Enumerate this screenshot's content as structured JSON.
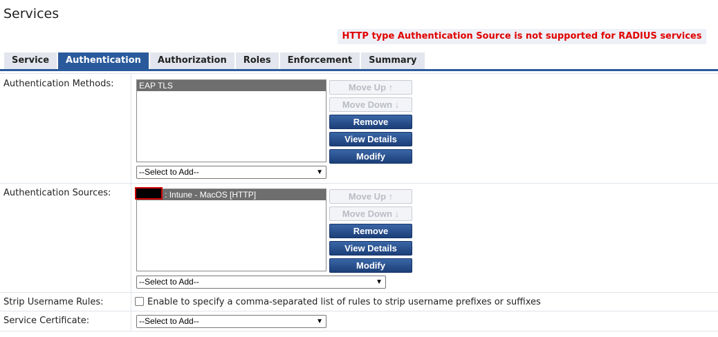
{
  "page": {
    "title": "Services"
  },
  "alert": {
    "text": "HTTP type Authentication Source is not supported for RADIUS services"
  },
  "tabs": [
    {
      "label": "Service"
    },
    {
      "label": "Authentication"
    },
    {
      "label": "Authorization"
    },
    {
      "label": "Roles"
    },
    {
      "label": "Enforcement"
    },
    {
      "label": "Summary"
    }
  ],
  "active_tab": "Authentication",
  "auth_methods": {
    "label": "Authentication Methods:",
    "items": [
      "EAP TLS"
    ],
    "buttons": {
      "move_up": "Move Up ↑",
      "move_down": "Move Down ↓",
      "remove": "Remove",
      "view_details": "View Details",
      "modify": "Modify"
    },
    "select": "--Select to Add--"
  },
  "auth_sources": {
    "label": "Authentication Sources:",
    "items": [
      "Intune - MacOS [HTTP]"
    ],
    "item_prefix": ":",
    "buttons": {
      "move_up": "Move Up ↑",
      "move_down": "Move Down ↓",
      "remove": "Remove",
      "view_details": "View Details",
      "modify": "Modify"
    },
    "select": "--Select to Add--"
  },
  "strip_username": {
    "label": "Strip Username Rules:",
    "checkbox_label": "Enable to specify a comma-separated list of rules to strip username prefixes or suffixes",
    "checked": false
  },
  "service_certificate": {
    "label": "Service Certificate:",
    "select": "--Select to Add--"
  },
  "colors": {
    "accent": "#2a5a9c",
    "error": "#e00000",
    "selected_item": "#6e6e6e"
  },
  "icons": {
    "dropdown": "chevron-down-icon"
  }
}
